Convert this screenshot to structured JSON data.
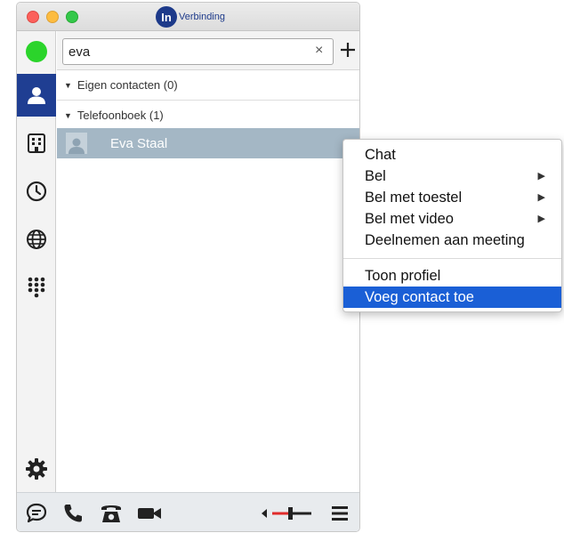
{
  "app": {
    "logo_letter": "In",
    "logo_text": "Verbinding"
  },
  "colors": {
    "accent": "#1f3e92",
    "status_online": "#2bd42b",
    "selection": "#a4b7c5",
    "menu_highlight": "#1a5fd6"
  },
  "sidebar": {
    "items": [
      {
        "icon": "status-online-icon",
        "active": false
      },
      {
        "icon": "contacts-icon",
        "active": true
      },
      {
        "icon": "directory-icon",
        "active": false
      },
      {
        "icon": "history-clock-icon",
        "active": false
      },
      {
        "icon": "globe-icon",
        "active": false
      },
      {
        "icon": "dialpad-icon",
        "active": false
      },
      {
        "icon": "settings-gear-icon",
        "active": false
      }
    ]
  },
  "search": {
    "value": "eva",
    "clear_symbol": "×",
    "add_symbol": "+"
  },
  "groups": [
    {
      "label": "Eigen contacten (0)",
      "arrow": "▼"
    },
    {
      "label": "Telefoonboek (1)",
      "arrow": "▼"
    }
  ],
  "contacts": [
    {
      "name": "Eva Staal"
    }
  ],
  "bottombar": {
    "items": [
      "chat-bubble-icon",
      "phone-handset-icon",
      "desk-phone-icon",
      "video-camera-icon",
      "volume-slider-icon",
      "menu-icon"
    ]
  },
  "context_menu": {
    "items": [
      {
        "label": "Chat",
        "submenu": false
      },
      {
        "label": "Bel",
        "submenu": true
      },
      {
        "label": "Bel met toestel",
        "submenu": true
      },
      {
        "label": "Bel met video",
        "submenu": true
      },
      {
        "label": "Deelnemen aan meeting",
        "submenu": false
      }
    ],
    "items_after_separator": [
      {
        "label": "Toon profiel",
        "highlighted": false
      },
      {
        "label": "Voeg contact toe",
        "highlighted": true
      }
    ],
    "submenu_arrow": "▶"
  }
}
